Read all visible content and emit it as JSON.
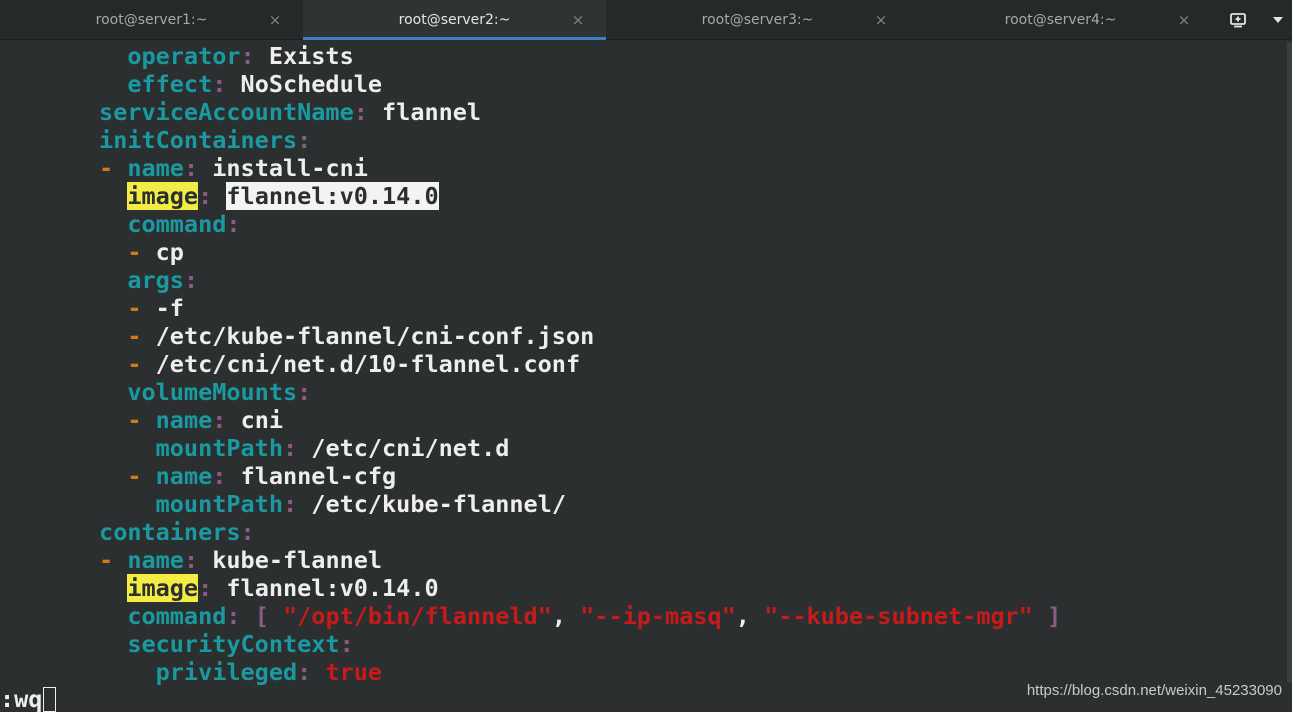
{
  "tabs": [
    {
      "title": "root@server1:~",
      "close": "×"
    },
    {
      "title": "root@server2:~",
      "close": "×"
    },
    {
      "title": "root@server3:~",
      "close": "×"
    },
    {
      "title": "root@server4:~",
      "close": "×"
    }
  ],
  "toolbar": {
    "new_tab_icon": "new-tab-icon",
    "menu_icon": "chevron-down-icon"
  },
  "yaml": {
    "l1_key": "operator",
    "l1_val": "Exists",
    "l2_key": "effect",
    "l2_val": "NoSchedule",
    "l3_key": "serviceAccountName",
    "l3_val": "flannel",
    "l4_key": "initContainers",
    "l5_key": "name",
    "l5_val": "install-cni",
    "l6_key": "image",
    "l6_val": "flannel:v0.14.0",
    "l7_key": "command",
    "l8_val": "cp",
    "l9_key": "args",
    "l10_val": "-f",
    "l11_val": "/etc/kube-flannel/cni-conf.json",
    "l12_val": "/etc/cni/net.d/10-flannel.conf",
    "l13_key": "volumeMounts",
    "l14_key": "name",
    "l14_val": "cni",
    "l15_key": "mountPath",
    "l15_val": "/etc/cni/net.d",
    "l16_key": "name",
    "l16_val": "flannel-cfg",
    "l17_key": "mountPath",
    "l17_val": "/etc/kube-flannel/",
    "l18_key": "containers",
    "l19_key": "name",
    "l19_val": "kube-flannel",
    "l20_key": "image",
    "l20_val": "flannel:v0.14.0",
    "l21_key": "command",
    "l21_s1": "\"/opt/bin/flanneld\"",
    "l21_s2": "\"--ip-masq\"",
    "l21_s3": "\"--kube-subnet-mgr\"",
    "l22_key": "securityContext",
    "l23_key": "privileged",
    "l23_val": "true"
  },
  "command_line": ":wq",
  "watermark": "https://blog.csdn.net/weixin_45233090",
  "colors": {
    "background": "#2b2f30",
    "key": "#1a9aa0",
    "dash": "#d3790d",
    "string": "#c71b1b",
    "search_highlight": "#f2ec43",
    "active_tab_accent": "#3d7fc4"
  }
}
